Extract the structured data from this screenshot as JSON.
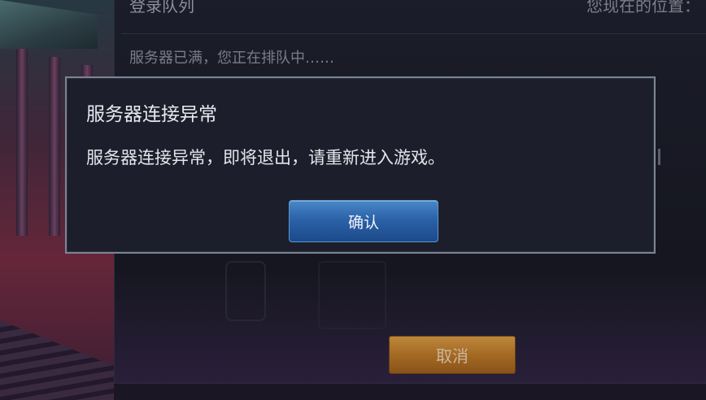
{
  "background": {
    "queue_title": "登录队列",
    "queue_position_text": "您现在的位置：",
    "queue_status": "服务器已满，您正在排队中……",
    "cancel_label": "取消"
  },
  "dialog": {
    "title": "服务器连接异常",
    "message": "服务器连接异常，即将退出，请重新进入游戏。",
    "confirm_label": "确认"
  },
  "colors": {
    "confirm_button": "#2b62a8",
    "cancel_button": "#b8741e",
    "modal_background": "#1c1e2b",
    "modal_border": "#7c8394"
  }
}
